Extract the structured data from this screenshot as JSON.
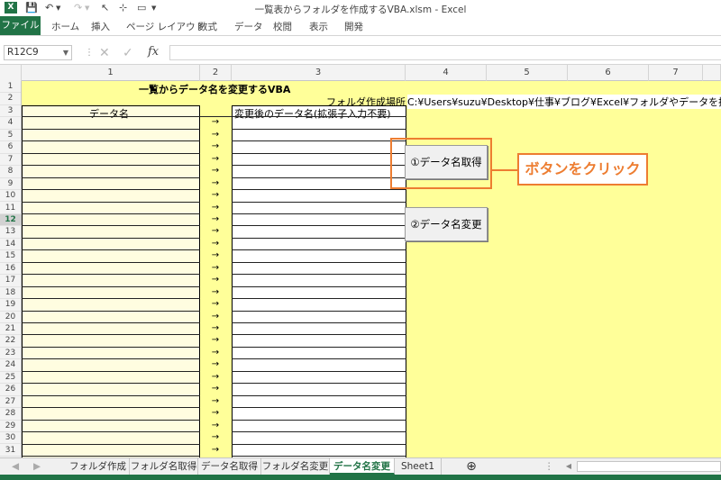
{
  "window": {
    "title": "一覧表からフォルダを作成するVBA.xlsm - Excel"
  },
  "ribbon": {
    "tabs": [
      "ファイル",
      "ホーム",
      "挿入",
      "ページ レイアウト",
      "数式",
      "データ",
      "校閲",
      "表示",
      "開発"
    ]
  },
  "formula_bar": {
    "name_box": "R12C9",
    "fx": "fx",
    "value": ""
  },
  "column_headers": [
    "1",
    "2",
    "3",
    "4",
    "5",
    "6",
    "7"
  ],
  "row_headers": [
    "1",
    "2",
    "3",
    "4",
    "5",
    "6",
    "7",
    "8",
    "9",
    "10",
    "11",
    "12",
    "13",
    "14",
    "15",
    "16",
    "17",
    "18",
    "19",
    "20",
    "21",
    "22",
    "23",
    "24",
    "25",
    "26",
    "27",
    "28",
    "29",
    "30",
    "31"
  ],
  "selected_row": "12",
  "sheet": {
    "title": "一覧からデータ名を変更するVBA",
    "folder_label": "フォルダ作成場所",
    "folder_path": "C:¥Users¥suzu¥Desktop¥仕事¥ブログ¥Excel¥フォルダやデータを操作",
    "col1_header": "データ名",
    "col3_header": "変更後のデータ名(拡張子入力不要)",
    "arrow": "→"
  },
  "buttons": {
    "get_names": "①データ名取得",
    "change_names": "②データ名変更"
  },
  "callout": {
    "text": "ボタンをクリック",
    "color": "#ed7d31"
  },
  "sheet_tabs": [
    "フォルダ作成",
    "フォルダ名取得",
    "データ名取得",
    "フォルダ名変更",
    "データ名変更",
    "Sheet1"
  ],
  "active_tab": "データ名変更",
  "colors": {
    "excel_green": "#217346",
    "cell_yellow": "#ffff99"
  }
}
